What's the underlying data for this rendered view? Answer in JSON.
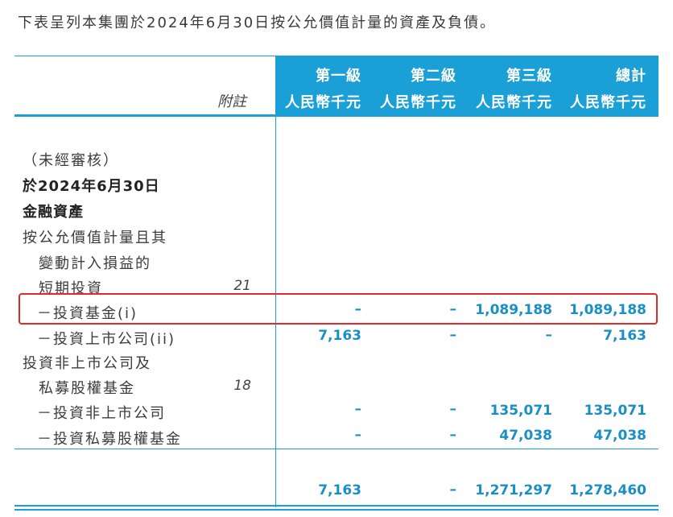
{
  "intro_text": "下表呈列本集團於2024年6月30日按公允價值計量的資產及負債。",
  "header": {
    "note_label": "附註",
    "columns": [
      {
        "level": "第一級",
        "unit": "人民幣千元"
      },
      {
        "level": "第二級",
        "unit": "人民幣千元"
      },
      {
        "level": "第三級",
        "unit": "人民幣千元"
      },
      {
        "level": "總計",
        "unit": "人民幣千元"
      }
    ]
  },
  "body": {
    "unaudited": "（未經審核）",
    "date_heading": "於2024年6月30日",
    "section_heading": "金融資產",
    "group1_line1": "按公允價值計量且其",
    "group1_line2": "變動計入損益的",
    "group1_line3": "短期投資",
    "group1_note": "21",
    "group2_line1": "投資非上市公司及",
    "group2_line2": "私募股權基金",
    "group2_note": "18"
  },
  "rows": [
    {
      "label": "－投資基金(i)",
      "level1": "–",
      "level2": "–",
      "level3": "1,089,188",
      "total": "1,089,188"
    },
    {
      "label": "－投資上市公司(ii)",
      "level1": "7,163",
      "level2": "–",
      "level3": "–",
      "total": "7,163"
    },
    {
      "label": "－投資非上市公司",
      "level1": "–",
      "level2": "–",
      "level3": "135,071",
      "total": "135,071"
    },
    {
      "label": "－投資私募股權基金",
      "level1": "–",
      "level2": "–",
      "level3": "47,038",
      "total": "47,038"
    }
  ],
  "totals": {
    "level1": "7,163",
    "level2": "–",
    "level3": "1,271,297",
    "total": "1,278,460"
  },
  "colors": {
    "accent": "#1aa0d6",
    "number": "#1a8fc6",
    "highlight": "#e02a2a"
  }
}
